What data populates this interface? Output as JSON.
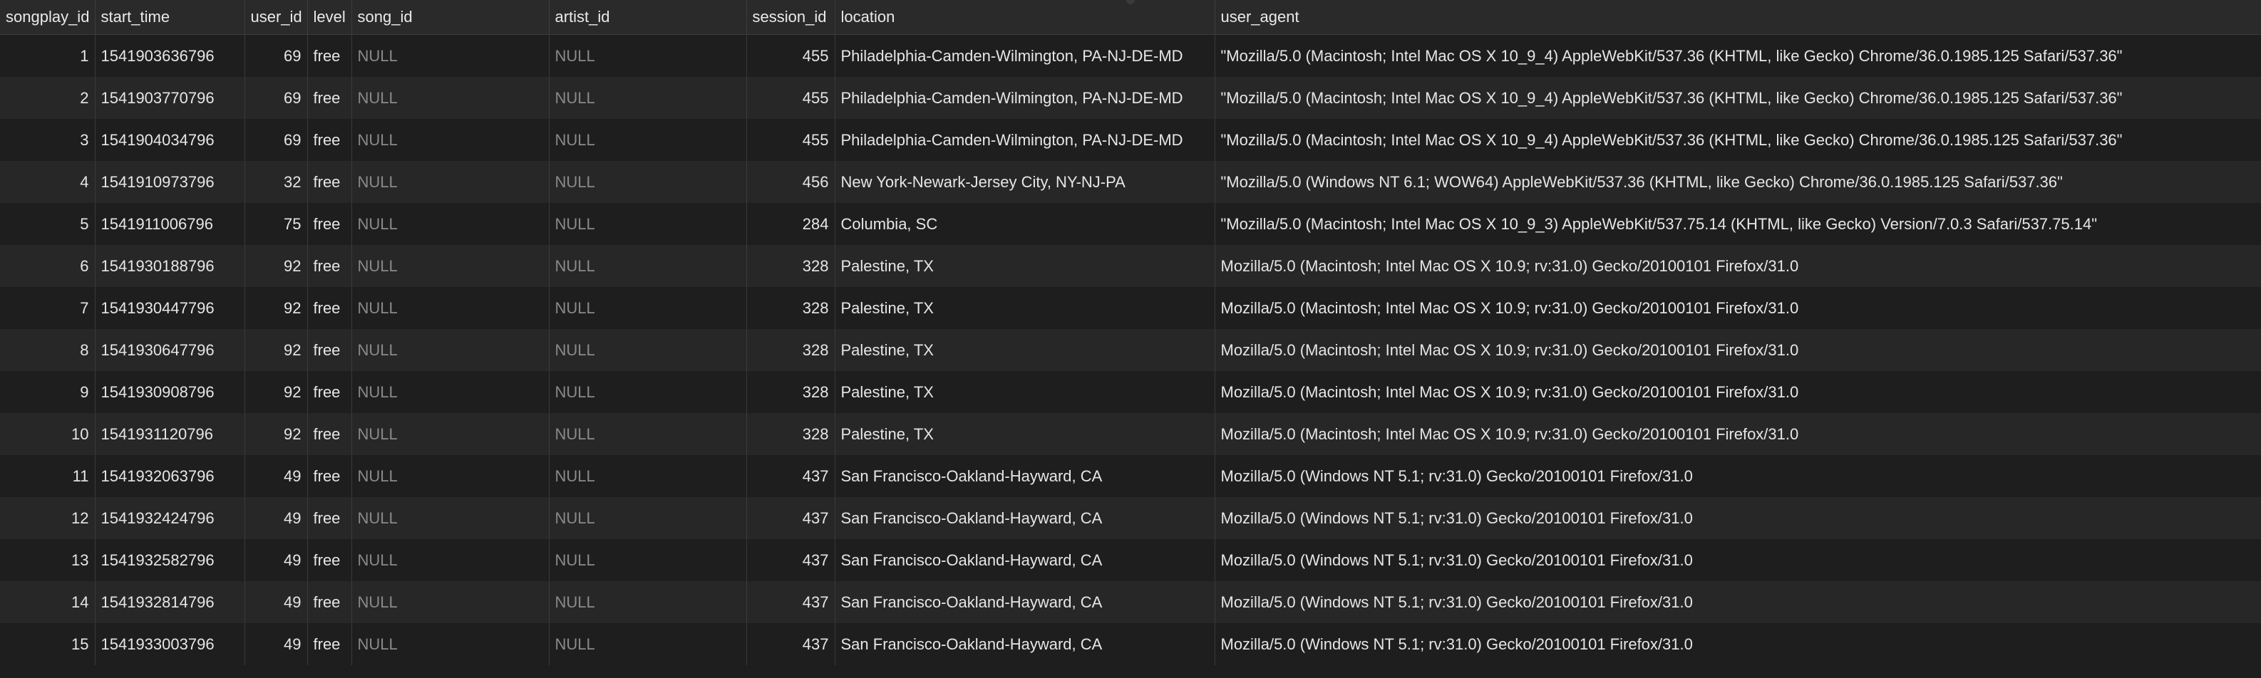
{
  "columns": [
    "songplay_id",
    "start_time",
    "user_id",
    "level",
    "song_id",
    "artist_id",
    "session_id",
    "location",
    "user_agent"
  ],
  "rows": [
    {
      "songplay_id": "1",
      "start_time": "1541903636796",
      "user_id": "69",
      "level": "free",
      "song_id": "NULL",
      "artist_id": "NULL",
      "session_id": "455",
      "location": "Philadelphia-Camden-Wilmington, PA-NJ-DE-MD",
      "user_agent": "\"Mozilla/5.0 (Macintosh; Intel Mac OS X 10_9_4) AppleWebKit/537.36 (KHTML, like Gecko) Chrome/36.0.1985.125 Safari/537.36\""
    },
    {
      "songplay_id": "2",
      "start_time": "1541903770796",
      "user_id": "69",
      "level": "free",
      "song_id": "NULL",
      "artist_id": "NULL",
      "session_id": "455",
      "location": "Philadelphia-Camden-Wilmington, PA-NJ-DE-MD",
      "user_agent": "\"Mozilla/5.0 (Macintosh; Intel Mac OS X 10_9_4) AppleWebKit/537.36 (KHTML, like Gecko) Chrome/36.0.1985.125 Safari/537.36\""
    },
    {
      "songplay_id": "3",
      "start_time": "1541904034796",
      "user_id": "69",
      "level": "free",
      "song_id": "NULL",
      "artist_id": "NULL",
      "session_id": "455",
      "location": "Philadelphia-Camden-Wilmington, PA-NJ-DE-MD",
      "user_agent": "\"Mozilla/5.0 (Macintosh; Intel Mac OS X 10_9_4) AppleWebKit/537.36 (KHTML, like Gecko) Chrome/36.0.1985.125 Safari/537.36\""
    },
    {
      "songplay_id": "4",
      "start_time": "1541910973796",
      "user_id": "32",
      "level": "free",
      "song_id": "NULL",
      "artist_id": "NULL",
      "session_id": "456",
      "location": "New York-Newark-Jersey City, NY-NJ-PA",
      "user_agent": "\"Mozilla/5.0 (Windows NT 6.1; WOW64) AppleWebKit/537.36 (KHTML, like Gecko) Chrome/36.0.1985.125 Safari/537.36\""
    },
    {
      "songplay_id": "5",
      "start_time": "1541911006796",
      "user_id": "75",
      "level": "free",
      "song_id": "NULL",
      "artist_id": "NULL",
      "session_id": "284",
      "location": "Columbia, SC",
      "user_agent": "\"Mozilla/5.0 (Macintosh; Intel Mac OS X 10_9_3) AppleWebKit/537.75.14 (KHTML, like Gecko) Version/7.0.3 Safari/537.75.14\""
    },
    {
      "songplay_id": "6",
      "start_time": "1541930188796",
      "user_id": "92",
      "level": "free",
      "song_id": "NULL",
      "artist_id": "NULL",
      "session_id": "328",
      "location": "Palestine, TX",
      "user_agent": "Mozilla/5.0 (Macintosh; Intel Mac OS X 10.9; rv:31.0) Gecko/20100101 Firefox/31.0"
    },
    {
      "songplay_id": "7",
      "start_time": "1541930447796",
      "user_id": "92",
      "level": "free",
      "song_id": "NULL",
      "artist_id": "NULL",
      "session_id": "328",
      "location": "Palestine, TX",
      "user_agent": "Mozilla/5.0 (Macintosh; Intel Mac OS X 10.9; rv:31.0) Gecko/20100101 Firefox/31.0"
    },
    {
      "songplay_id": "8",
      "start_time": "1541930647796",
      "user_id": "92",
      "level": "free",
      "song_id": "NULL",
      "artist_id": "NULL",
      "session_id": "328",
      "location": "Palestine, TX",
      "user_agent": "Mozilla/5.0 (Macintosh; Intel Mac OS X 10.9; rv:31.0) Gecko/20100101 Firefox/31.0"
    },
    {
      "songplay_id": "9",
      "start_time": "1541930908796",
      "user_id": "92",
      "level": "free",
      "song_id": "NULL",
      "artist_id": "NULL",
      "session_id": "328",
      "location": "Palestine, TX",
      "user_agent": "Mozilla/5.0 (Macintosh; Intel Mac OS X 10.9; rv:31.0) Gecko/20100101 Firefox/31.0"
    },
    {
      "songplay_id": "10",
      "start_time": "1541931120796",
      "user_id": "92",
      "level": "free",
      "song_id": "NULL",
      "artist_id": "NULL",
      "session_id": "328",
      "location": "Palestine, TX",
      "user_agent": "Mozilla/5.0 (Macintosh; Intel Mac OS X 10.9; rv:31.0) Gecko/20100101 Firefox/31.0"
    },
    {
      "songplay_id": "11",
      "start_time": "1541932063796",
      "user_id": "49",
      "level": "free",
      "song_id": "NULL",
      "artist_id": "NULL",
      "session_id": "437",
      "location": "San Francisco-Oakland-Hayward, CA",
      "user_agent": "Mozilla/5.0 (Windows NT 5.1; rv:31.0) Gecko/20100101 Firefox/31.0"
    },
    {
      "songplay_id": "12",
      "start_time": "1541932424796",
      "user_id": "49",
      "level": "free",
      "song_id": "NULL",
      "artist_id": "NULL",
      "session_id": "437",
      "location": "San Francisco-Oakland-Hayward, CA",
      "user_agent": "Mozilla/5.0 (Windows NT 5.1; rv:31.0) Gecko/20100101 Firefox/31.0"
    },
    {
      "songplay_id": "13",
      "start_time": "1541932582796",
      "user_id": "49",
      "level": "free",
      "song_id": "NULL",
      "artist_id": "NULL",
      "session_id": "437",
      "location": "San Francisco-Oakland-Hayward, CA",
      "user_agent": "Mozilla/5.0 (Windows NT 5.1; rv:31.0) Gecko/20100101 Firefox/31.0"
    },
    {
      "songplay_id": "14",
      "start_time": "1541932814796",
      "user_id": "49",
      "level": "free",
      "song_id": "NULL",
      "artist_id": "NULL",
      "session_id": "437",
      "location": "San Francisco-Oakland-Hayward, CA",
      "user_agent": "Mozilla/5.0 (Windows NT 5.1; rv:31.0) Gecko/20100101 Firefox/31.0"
    },
    {
      "songplay_id": "15",
      "start_time": "1541933003796",
      "user_id": "49",
      "level": "free",
      "song_id": "NULL",
      "artist_id": "NULL",
      "session_id": "437",
      "location": "San Francisco-Oakland-Hayward, CA",
      "user_agent": "Mozilla/5.0 (Windows NT 5.1; rv:31.0) Gecko/20100101 Firefox/31.0"
    }
  ]
}
